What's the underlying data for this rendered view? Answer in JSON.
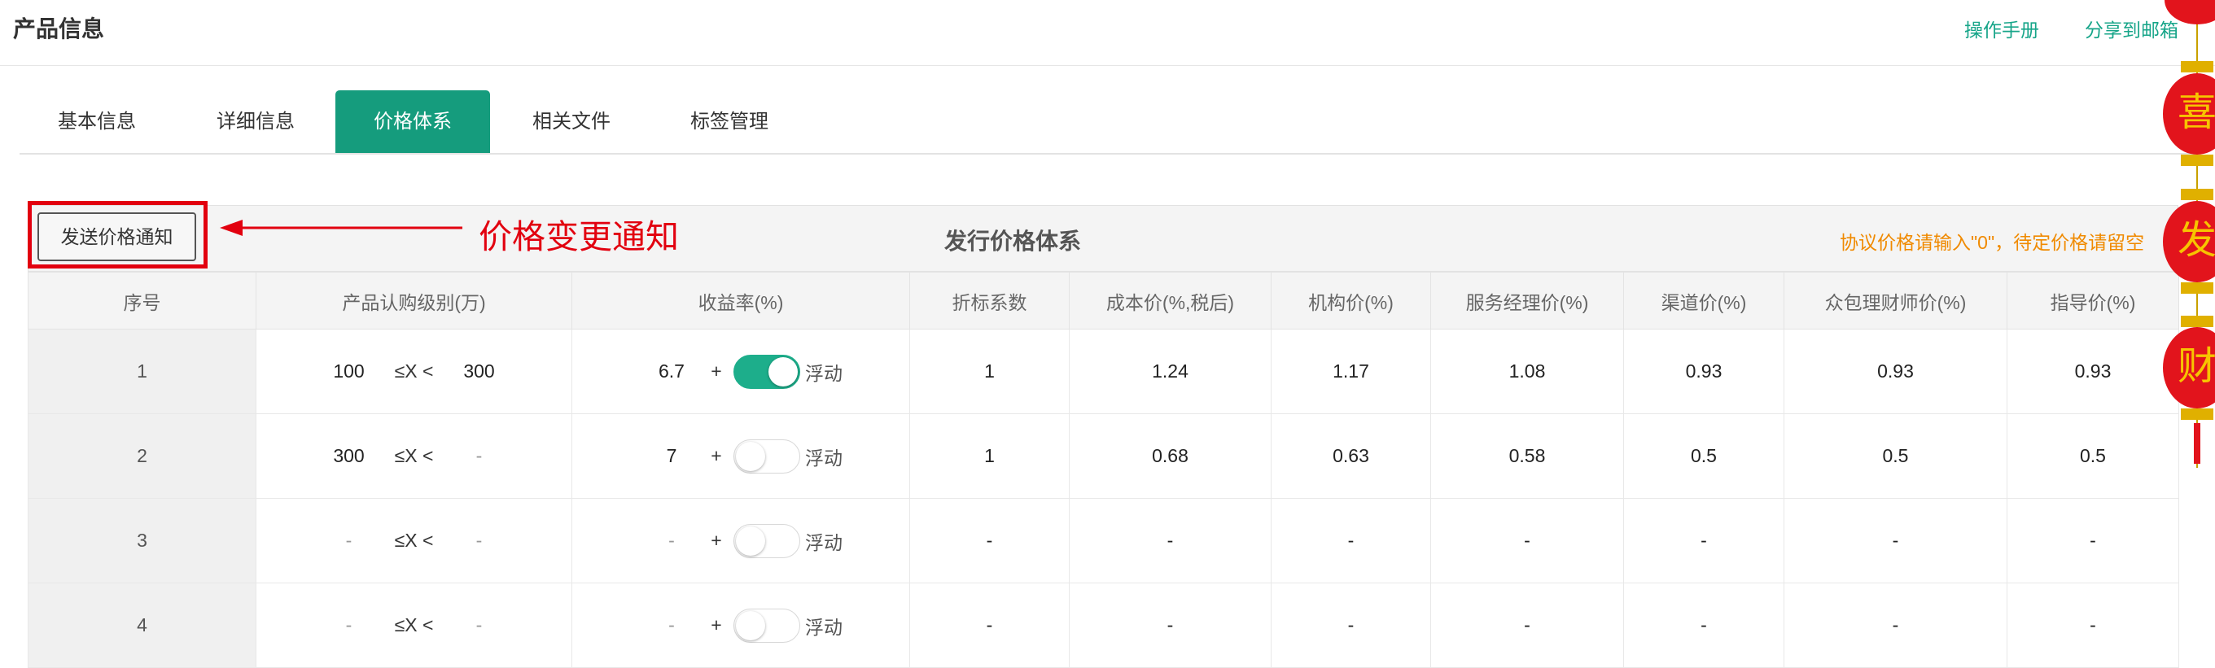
{
  "header": {
    "title": "产品信息",
    "links": {
      "manual": "操作手册",
      "share": "分享到邮箱"
    }
  },
  "tabs": [
    {
      "label": "基本信息",
      "active": false
    },
    {
      "label": "详细信息",
      "active": false
    },
    {
      "label": "价格体系",
      "active": true
    },
    {
      "label": "相关文件",
      "active": false
    },
    {
      "label": "标签管理",
      "active": false
    }
  ],
  "panel": {
    "send_button": "发送价格通知",
    "annotation": "价格变更通知",
    "title": "发行价格体系",
    "note": "协议价格请输入\"0\"，待定价格请留空"
  },
  "table": {
    "columns": [
      "序号",
      "产品认购级别(万)",
      "收益率(%)",
      "折标系数",
      "成本价(%,税后)",
      "机构价(%)",
      "服务经理价(%)",
      "渠道价(%)",
      "众包理财师价(%)",
      "指导价(%)"
    ],
    "range_operator": "≤X <",
    "yield_plus": "+",
    "float_label": "浮动",
    "rows": [
      {
        "seq": "1",
        "min": "100",
        "max": "300",
        "yield": "6.7",
        "floating": true,
        "discount": "1",
        "cost": "1.24",
        "institution": "1.17",
        "manager": "1.08",
        "channel": "0.93",
        "crowd": "0.93",
        "guide": "0.93"
      },
      {
        "seq": "2",
        "min": "300",
        "max": "-",
        "yield": "7",
        "floating": false,
        "discount": "1",
        "cost": "0.68",
        "institution": "0.63",
        "manager": "0.58",
        "channel": "0.5",
        "crowd": "0.5",
        "guide": "0.5"
      },
      {
        "seq": "3",
        "min": "-",
        "max": "-",
        "yield": "-",
        "floating": false,
        "discount": "-",
        "cost": "-",
        "institution": "-",
        "manager": "-",
        "channel": "-",
        "crowd": "-",
        "guide": "-"
      },
      {
        "seq": "4",
        "min": "-",
        "max": "-",
        "yield": "-",
        "floating": false,
        "discount": "-",
        "cost": "-",
        "institution": "-",
        "manager": "-",
        "channel": "-",
        "crowd": "-",
        "guide": "-"
      }
    ]
  },
  "decoration": {
    "lantern_chars": [
      "喜",
      "发",
      "财"
    ],
    "lantern_color": "#e2141c",
    "char_color": "#f7c400"
  },
  "colors": {
    "accent": "#159c7d",
    "toggle_on": "#1dae8b",
    "note": "#f08a00",
    "annotation": "#e2000f"
  }
}
